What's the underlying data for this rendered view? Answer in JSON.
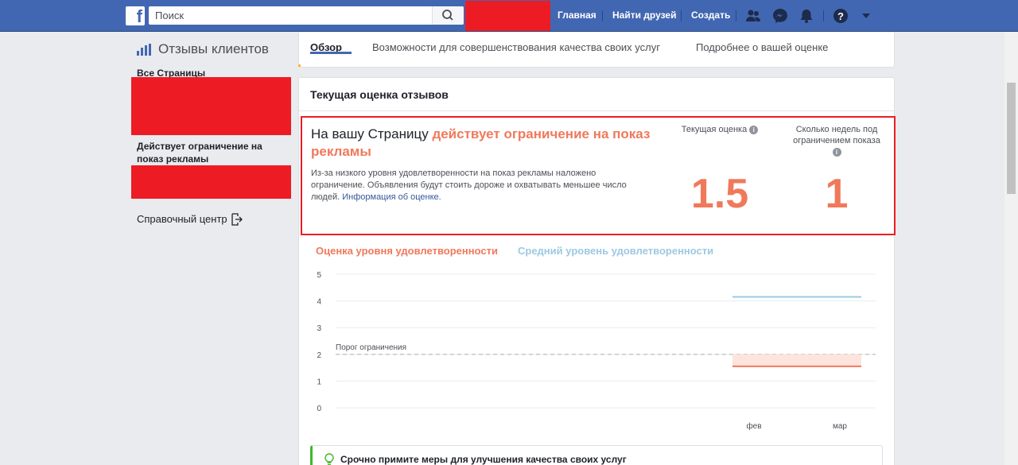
{
  "topbar": {
    "logo": "f",
    "search_placeholder": "Поиск",
    "nav": {
      "home": "Главная",
      "find_friends": "Найти друзей",
      "create": "Создать"
    },
    "icons": [
      "friends-icon",
      "messenger-icon",
      "notifications-icon",
      "help-icon",
      "chevron-down-icon"
    ]
  },
  "sidebar": {
    "title": "Отзывы клиентов",
    "all_pages": "Все Страницы",
    "restricted": "Действует ограничение на показ рекламы",
    "help_center": "Справочный центр"
  },
  "tabs": [
    {
      "label": "Обзор",
      "active": true
    },
    {
      "label": "Возможности для совершенствования качества своих услуг",
      "active": false
    },
    {
      "label": "Подробнее о вашей оценке",
      "active": false
    }
  ],
  "card": {
    "title": "Текущая оценка отзывов",
    "warning_prefix": "На вашу Страницу ",
    "warning_highlight": "действует ограничение на показ рекламы",
    "description": "Из-за низкого уровня удовлетворенности на показ рекламы наложено ограничение. Объявления будут стоить дороже и охватывать меньшее число людей.",
    "info_link": "Информация об оценке.",
    "current_score_label": "Текущая оценка",
    "current_score": "1.5",
    "weeks_label": "Сколько недель под ограничением показа",
    "weeks": "1"
  },
  "chart_data": {
    "type": "line",
    "categories": [
      "фев",
      "мар"
    ],
    "ylim": [
      0,
      5
    ],
    "yticks": [
      "0",
      "1",
      "2",
      "3",
      "4",
      "5"
    ],
    "grid": true,
    "legend_placement": "top-left",
    "series": [
      {
        "name": "Оценка уровня удовлетворенности",
        "color": "#f0795b",
        "values": [
          1.55,
          1.55
        ]
      },
      {
        "name": "Средний уровень удовлетворенности",
        "color": "#9cc9e2",
        "values": [
          4.15,
          4.15
        ]
      }
    ],
    "threshold": {
      "label": "Порог ограничения",
      "value": 2
    }
  },
  "tip": {
    "text": "Срочно примите меры для улучшения качества своих услуг"
  }
}
